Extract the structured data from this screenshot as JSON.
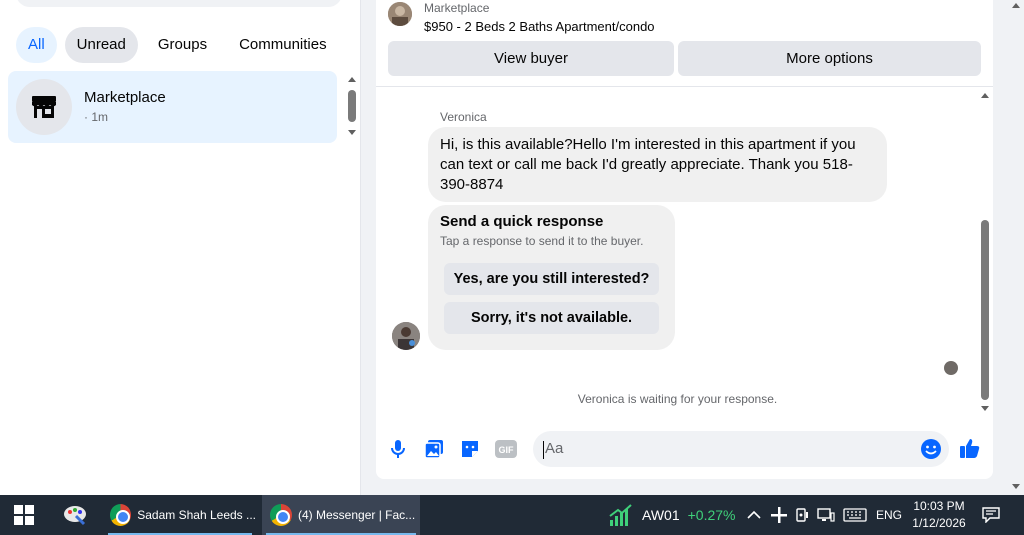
{
  "left": {
    "filters": [
      "All",
      "Unread",
      "Groups",
      "Communities"
    ],
    "conversation": {
      "title": "Marketplace",
      "sub": "· 1m"
    }
  },
  "chat": {
    "header": {
      "name": "Marketplace",
      "title": "$950 - 2 Beds 2 Baths Apartment/condo"
    },
    "actions": {
      "view_buyer": "View buyer",
      "more_options": "More options"
    },
    "sender": "Veronica",
    "message": "Hi, is this available?Hello I'm interested in this apartment if you can text or call me back I'd greatly appreciate. Thank you 518-390-8874",
    "quick_response": {
      "title": "Send a quick response",
      "subtitle": "Tap a response to send it to the buyer.",
      "options": [
        "Yes, are you still interested?",
        "Sorry, it's not available."
      ]
    },
    "waiting": "Veronica is waiting for your response.",
    "composer": {
      "placeholder": "Aa",
      "gif": "GIF"
    }
  },
  "taskbar": {
    "items": [
      {
        "label": "Sadam Shah Leeds ..."
      },
      {
        "label": "(4) Messenger | Fac..."
      }
    ],
    "stock": {
      "symbol": "AW01",
      "change": "+0.27%"
    },
    "lang": "ENG",
    "time": "10:03 PM",
    "date": "1/12/2026"
  },
  "colors": {
    "accent": "#0866ff",
    "stock_green": "#3fd07a"
  }
}
